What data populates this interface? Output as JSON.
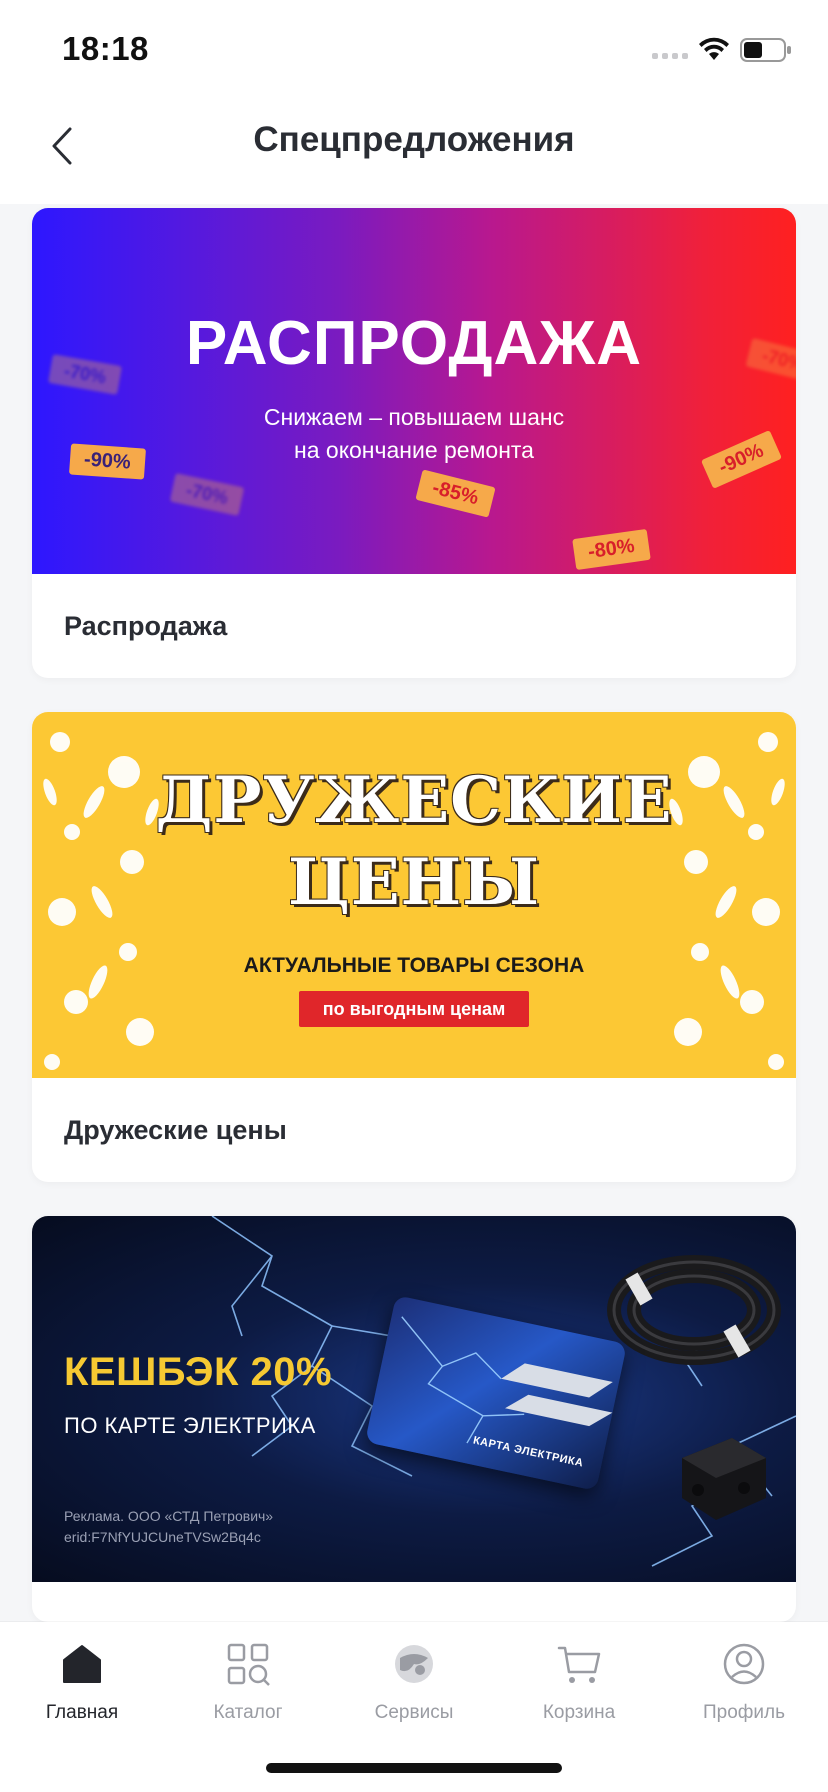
{
  "status_bar": {
    "time": "18:18"
  },
  "header": {
    "title": "Спецпредложения"
  },
  "cards": [
    {
      "label": "Распродажа",
      "banner": {
        "title": "РАСПРОДАЖА",
        "subtitle_line1": "Снижаем – повышаем шанс",
        "subtitle_line2": "на окончание ремонта",
        "tags": [
          "-70%",
          "-90%",
          "-85%",
          "-80%",
          "-90%",
          "-70%",
          "-70%"
        ]
      }
    },
    {
      "label": "Дружеские цены",
      "banner": {
        "title_line1": "ДРУЖЕСКИЕ",
        "title_line2": "ЦЕНЫ",
        "subtitle": "АКТУАЛЬНЫЕ ТОВАРЫ СЕЗОНА",
        "pill": "по выгодным ценам"
      }
    },
    {
      "label": "",
      "banner": {
        "title": "КЕШБЭК 20%",
        "subtitle": "ПО КАРТЕ ЭЛЕКТРИКА",
        "ad_line1": "Реклама. ООО «СТД Петрович»",
        "ad_line2": "erid:F7NfYUJCUneTVSw2Bq4c",
        "card_text": "КАРТА ЭЛЕКТРИКА"
      }
    }
  ],
  "tab_bar": {
    "items": [
      {
        "label": "Главная",
        "icon": "home-icon",
        "active": true
      },
      {
        "label": "Каталог",
        "icon": "catalog-icon",
        "active": false
      },
      {
        "label": "Сервисы",
        "icon": "services-icon",
        "active": false
      },
      {
        "label": "Корзина",
        "icon": "cart-icon",
        "active": false
      },
      {
        "label": "Профиль",
        "icon": "profile-icon",
        "active": false
      }
    ]
  },
  "colors": {
    "accent_red": "#e0262a",
    "yellow": "#fcc834",
    "text_dark": "#23252b",
    "text_muted": "#9a9ca3"
  }
}
